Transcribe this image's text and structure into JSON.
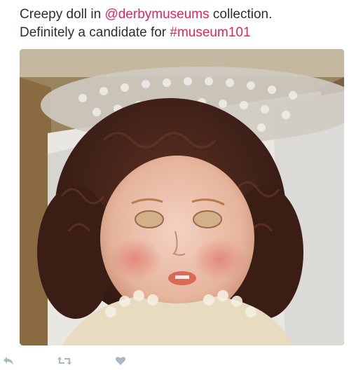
{
  "tweet": {
    "text_prefix": "Creepy doll in ",
    "mention": "@derbymuseums",
    "text_middle": " collection.",
    "text_line2": "Definitely a candidate for ",
    "hashtag": "#museum101",
    "link_color": "#e0245e",
    "text_color": "#292f33"
  },
  "media": {
    "alt": "Photo of an antique doll with brown curly hair lying in a box"
  },
  "actions": [
    {
      "icon": "reply-icon"
    },
    {
      "icon": "retweet-icon"
    },
    {
      "icon": "like-icon"
    }
  ]
}
